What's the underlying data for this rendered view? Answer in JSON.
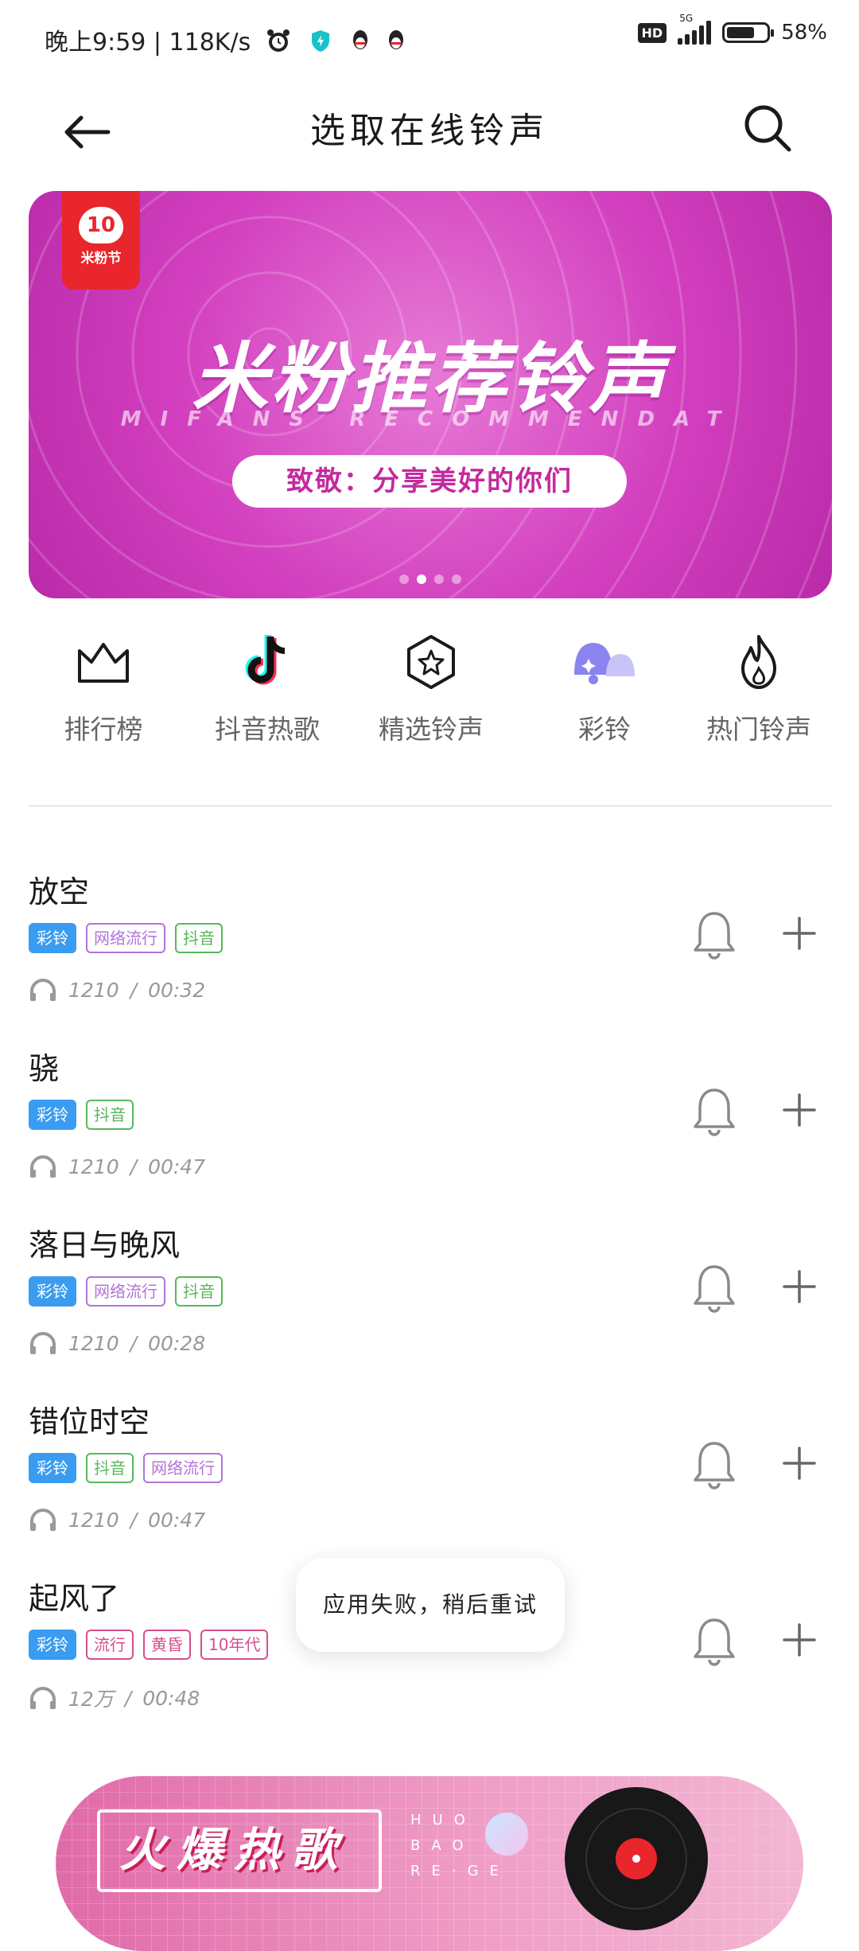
{
  "status_bar": {
    "time_text": "晚上9:59 | 118K/s",
    "hd": "HD",
    "network": "5G",
    "battery_text": "58%",
    "battery_level": 0.58
  },
  "header": {
    "title": "选取在线铃声"
  },
  "banner": {
    "badge_number": "10",
    "badge_text": "米粉节",
    "title": "米粉推荐铃声",
    "subtitle": "MIFANS RECOMMENDAT",
    "pill_text": "致敬：分享美好的你们",
    "page_count": 4,
    "active_page": 2
  },
  "categories": [
    {
      "label": "排行榜",
      "icon": "crown-icon"
    },
    {
      "label": "抖音热歌",
      "icon": "tiktok-icon"
    },
    {
      "label": "精选铃声",
      "icon": "star-hexagon-icon"
    },
    {
      "label": "彩铃",
      "icon": "bells-icon"
    },
    {
      "label": "热门铃声",
      "icon": "flame-icon"
    }
  ],
  "ringtones": [
    {
      "name": "放空",
      "tags": [
        "彩铃",
        "网络流行",
        "抖音"
      ],
      "plays": "1210",
      "separator": "/",
      "duration": "00:32"
    },
    {
      "name": "骁",
      "tags": [
        "彩铃",
        "抖音"
      ],
      "plays": "1210",
      "separator": "/",
      "duration": "00:47"
    },
    {
      "name": "落日与晚风",
      "tags": [
        "彩铃",
        "网络流行",
        "抖音"
      ],
      "plays": "1210",
      "separator": "/",
      "duration": "00:28"
    },
    {
      "name": "错位时空",
      "tags": [
        "彩铃",
        "抖音",
        "网络流行"
      ],
      "plays": "1210",
      "separator": "/",
      "duration": "00:47"
    },
    {
      "name": "起风了",
      "tags": [
        "彩铃",
        "流行",
        "黄昏",
        "10年代"
      ],
      "plays": "12万",
      "separator": "/",
      "duration": "00:48"
    }
  ],
  "toast": {
    "message": "应用失败，稍后重试"
  },
  "promo": {
    "title": "火爆热歌",
    "pinyin_1": "HUO",
    "pinyin_2": "BAO",
    "pinyin_3": "RE·GE"
  },
  "colors": {
    "caling_tag": "#3a9cf0",
    "banner_pink": "#d23fbf",
    "promo_pink": "#e06aa8"
  }
}
